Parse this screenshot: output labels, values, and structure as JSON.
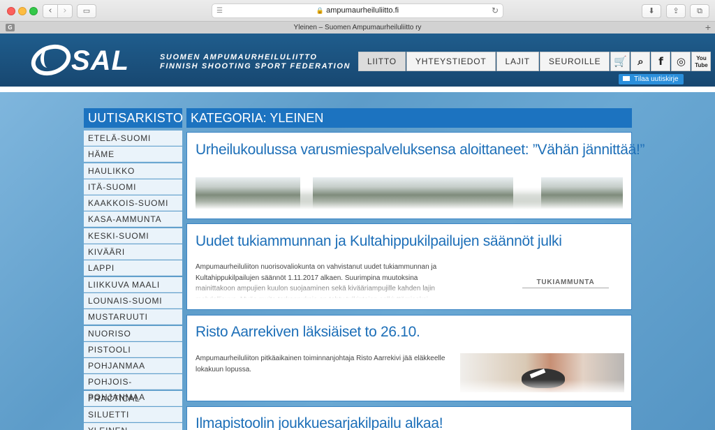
{
  "browser": {
    "url": "ampumaurheiluliitto.fi",
    "tab_title": "Yleinen – Suomen Ampumaurheiluliitto ry",
    "favicon_letter": "G",
    "icons": {
      "back": "chevron-left-icon",
      "forward": "chevron-right-icon",
      "sidebar": "sidebar-icon",
      "download": "download-icon",
      "share": "share-icon",
      "tabs": "tabs-icon",
      "reader": "reader-icon",
      "reload": "reload-icon",
      "lock": "lock-icon",
      "new_tab": "plus-icon"
    },
    "new_tab_symbol": "+"
  },
  "header": {
    "logo_text": "SAL",
    "tagline_line1": "SUOMEN AMPUMAURHEILULIITTO",
    "tagline_line2": "FINNISH SHOOTING SPORT FEDERATION",
    "nav": [
      {
        "label": "LIITTO",
        "active": true
      },
      {
        "label": "YHTEYSTIEDOT",
        "active": false
      },
      {
        "label": "LAJIT",
        "active": false
      },
      {
        "label": "SEUROILLE",
        "active": false
      }
    ],
    "icon_buttons": [
      {
        "icon": "cart-icon",
        "glyph": "🛒"
      },
      {
        "icon": "search-icon",
        "glyph": "⌕"
      },
      {
        "icon": "facebook-icon",
        "glyph": "f"
      },
      {
        "icon": "instagram-icon",
        "glyph": "◎"
      }
    ],
    "youtube_line1": "You",
    "youtube_line2": "Tube",
    "subscribe_label": "Tilaa uutiskirje",
    "brand_color": "#1f5d8d",
    "accent_color": "#1c73c0"
  },
  "sidebar": {
    "title": "UUTISARKISTO",
    "items": [
      "ETELÄ-SUOMI",
      "HÄME",
      "HAULIKKO",
      "ITÄ-SUOMI",
      "KAAKKOIS-SUOMI",
      "KASA-AMMUNTA",
      "KESKI-SUOMI",
      "KIVÄÄRI",
      "LAPPI",
      "LIIKKUVA MAALI",
      "LOUNAIS-SUOMI",
      "MUSTARUUTI",
      "NUORISO",
      "PISTOOLI",
      "POHJANMAA",
      "POHJOIS-POHJANMAA",
      "PRACTICAL",
      "SILUETTI",
      "YLEINEN"
    ]
  },
  "main": {
    "category_title": "KATEGORIA: YLEINEN",
    "articles": [
      {
        "title": "Urheilukoulussa varusmiespalveluksensa aloittaneet: ”Vähän jännittää!”",
        "excerpt": ""
      },
      {
        "title": "Uudet tukiammunnan ja Kultahippukilpailujen säännöt julki",
        "excerpt": "Ampumaurheiluliiton nuorisovaliokunta on vahvistanut uudet tukiammunnan ja Kultahippukilpailujen säännöt 1.11.2017 alkaen. Suurimpina muutoksina mainittakoon ampujien kuulon suojaaminen sekä kivääriampujille kahden lajin mahdollisuus. Myös muita tarkennuksia on tehty tulkintojen selkiyttämiseksi. Uusista...",
        "thumb_label": "TUKIAMMUNTA"
      },
      {
        "title": "Risto Aarrekiven läksiäiset to 26.10.",
        "excerpt": "Ampumaurheiluliiton pitkäaikainen toiminnanjohtaja Risto Aarrekivi jää eläkkeelle lokakuun lopussa."
      },
      {
        "title": "Ilmapistoolin joukkuesarjakilpailu alkaa!",
        "excerpt": ""
      }
    ]
  }
}
